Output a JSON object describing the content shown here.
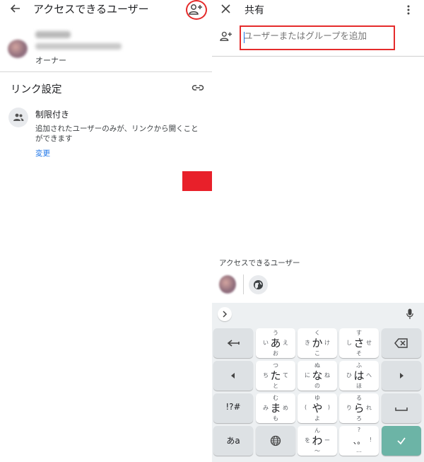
{
  "left": {
    "title": "アクセスできるユーザー",
    "owner_role": "オーナー",
    "link_settings": "リンク設定",
    "restriction_title": "制限付き",
    "restriction_desc": "追加されたユーザーのみが、リンクから開くことができます",
    "change_link": "変更"
  },
  "right": {
    "title": "共有",
    "search_placeholder": "ユーザーまたはグループを追加",
    "access_label": "アクセスできるユーザー"
  },
  "colors": {
    "highlight_red": "#e52b2b",
    "arrow_red": "#e8202a",
    "link_blue": "#1a73e8",
    "enter_key": "#6cb4a6"
  },
  "keyboard": {
    "rows": [
      [
        {
          "main": "あ",
          "top": "う",
          "bottom": "お",
          "left": "い",
          "right": "え"
        },
        {
          "main": "か",
          "top": "く",
          "bottom": "こ",
          "left": "き",
          "right": "け"
        },
        {
          "main": "さ",
          "top": "す",
          "bottom": "そ",
          "left": "し",
          "right": "せ"
        }
      ],
      [
        {
          "main": "た",
          "top": "つ",
          "bottom": "と",
          "left": "ち",
          "right": "て"
        },
        {
          "main": "な",
          "top": "ぬ",
          "bottom": "の",
          "left": "に",
          "right": "ね"
        },
        {
          "main": "は",
          "top": "ふ",
          "bottom": "ほ",
          "left": "ひ",
          "right": "へ"
        }
      ],
      [
        {
          "main": "ま",
          "top": "む",
          "bottom": "も",
          "left": "み",
          "right": "め"
        },
        {
          "main": "や",
          "top": "ゆ",
          "bottom": "よ",
          "left": "(",
          "right": ")"
        },
        {
          "main": "ら",
          "top": "る",
          "bottom": "ろ",
          "left": "り",
          "right": "れ"
        }
      ],
      [
        {
          "main": "わ",
          "top": "ん",
          "bottom": "〜",
          "left": "を",
          "right": "ー"
        },
        {
          "main": "、。",
          "top": "?",
          "bottom": "…",
          "left": "",
          "right": "!"
        }
      ]
    ],
    "symbols_key": "!?#",
    "kana_key": "あa"
  }
}
